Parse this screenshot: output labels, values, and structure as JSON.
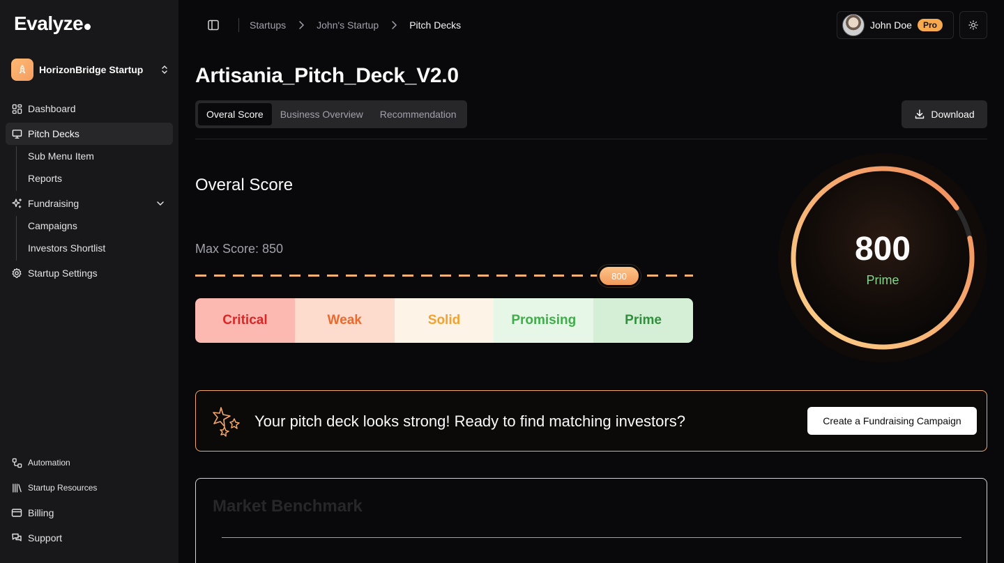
{
  "app": {
    "logo": "Evalyze"
  },
  "org": {
    "name": "HorizonBridge Startup"
  },
  "sidebar": {
    "items": [
      {
        "label": "Dashboard",
        "icon": "dashboard-icon"
      },
      {
        "label": "Pitch Decks",
        "icon": "presentation-icon",
        "active": true
      },
      {
        "label": "Sub Menu Item"
      },
      {
        "label": "Reports"
      },
      {
        "label": "Fundraising",
        "icon": "sparkles-icon"
      },
      {
        "label": "Campaigns"
      },
      {
        "label": "Investors Shortlist"
      },
      {
        "label": "Startup Settings",
        "icon": "gear-icon"
      }
    ],
    "bottom": [
      {
        "label": "Automation",
        "icon": "workflow-icon"
      },
      {
        "label": "Startup Resources",
        "icon": "library-icon"
      },
      {
        "label": "Billing",
        "icon": "credit-card-icon"
      },
      {
        "label": "Support",
        "icon": "chat-icon"
      }
    ]
  },
  "header": {
    "breadcrumb": [
      "Startups",
      "John's Startup",
      "Pitch Decks"
    ],
    "user": {
      "name": "John Doe",
      "badge": "Pro"
    }
  },
  "main": {
    "title": "Artisania_Pitch_Deck_V2.0",
    "tabs": [
      "Overal Score",
      "Business Overview",
      "Recommendation"
    ],
    "download_label": "Download",
    "section_title": "Overal Score",
    "max_score_label": "Max Score: 850",
    "score": "800",
    "score_fraction": 0.941,
    "score_rating": "Prime",
    "scale": [
      {
        "label": "Critical",
        "bg": "#fcb9b2",
        "color": "#dc2626"
      },
      {
        "label": "Weak",
        "bg": "#fddccd",
        "color": "#ea6a2e"
      },
      {
        "label": "Solid",
        "bg": "#fdf3e6",
        "color": "#f3a230"
      },
      {
        "label": "Promising",
        "bg": "#e6f6e7",
        "color": "#3fae4a"
      },
      {
        "label": "Prime",
        "bg": "#d5efd6",
        "color": "#2f8f3a"
      }
    ],
    "cta": {
      "text": "Your pitch deck looks strong! Ready to find matching investors?",
      "button": "Create a Fundraising Campaign"
    },
    "benchmark_title": "Market Benchmark"
  },
  "colors": {
    "accent": "#f6a94f",
    "gauge_start": "#fcd38a",
    "gauge_end": "#f08a5a",
    "prime": "#86d38f"
  }
}
